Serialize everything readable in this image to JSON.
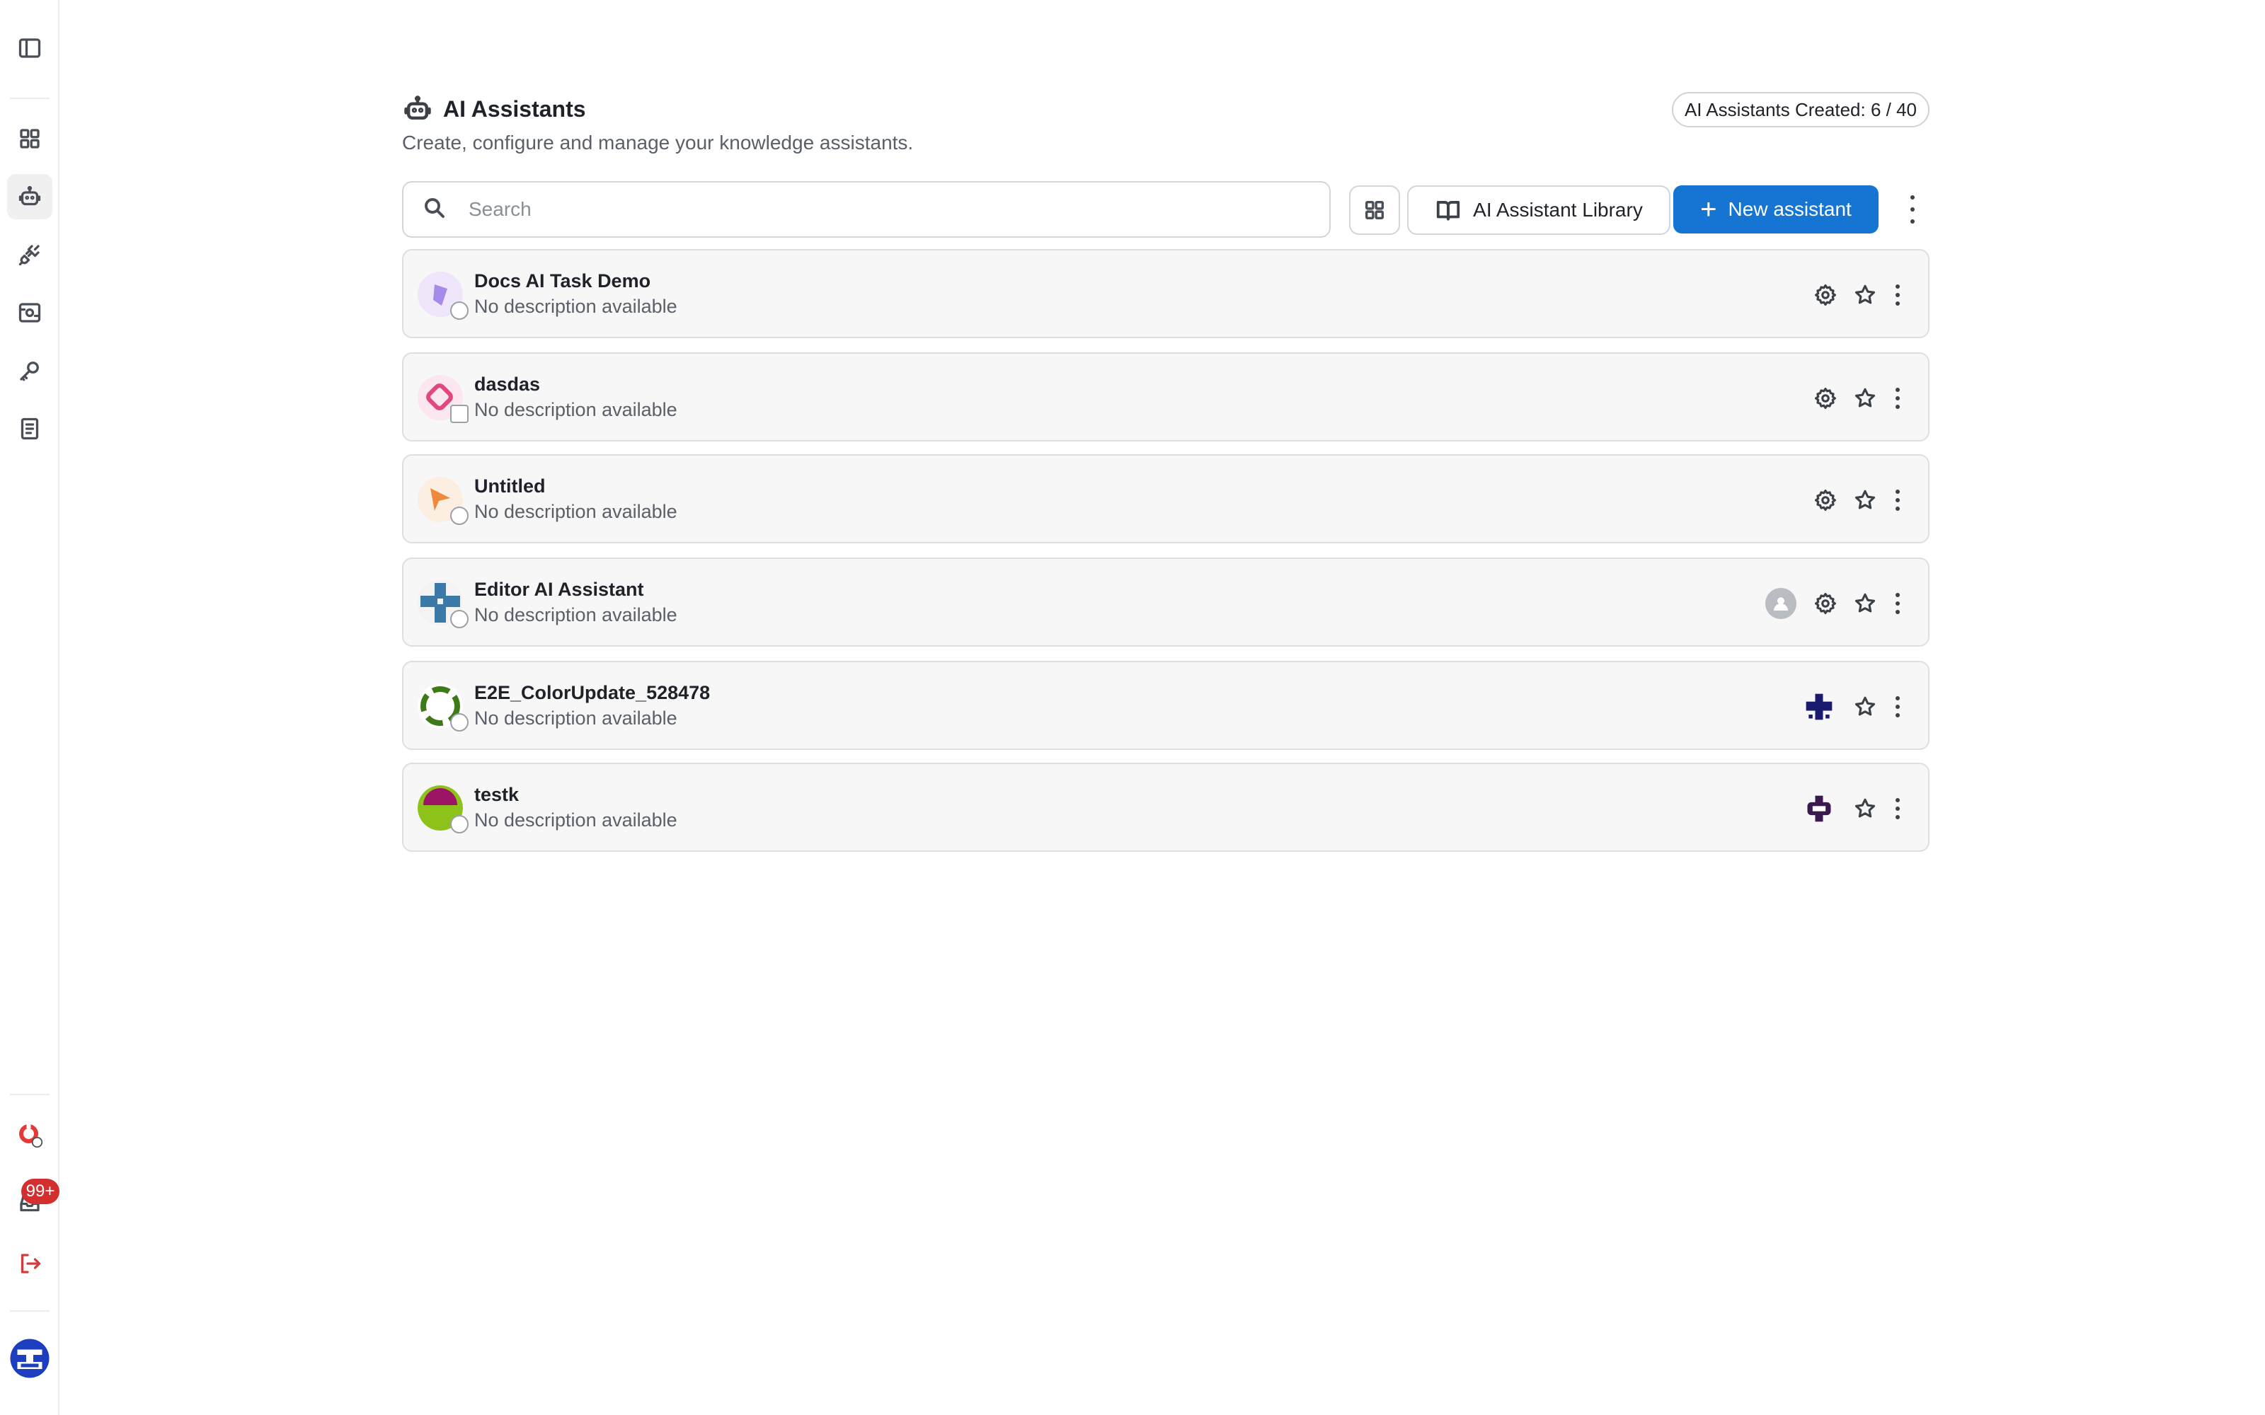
{
  "sidebar": {
    "notification_badge": "99+",
    "items": [
      {
        "name": "toggle-sidebar",
        "icon": "panel-left-icon"
      },
      {
        "name": "dashboard",
        "icon": "grid-icon"
      },
      {
        "name": "assistants",
        "icon": "robot-icon",
        "active": true
      },
      {
        "name": "integrations",
        "icon": "plug-icon"
      },
      {
        "name": "data-sources",
        "icon": "database-icon"
      },
      {
        "name": "api-keys",
        "icon": "key-icon"
      },
      {
        "name": "documentation",
        "icon": "book-icon"
      }
    ]
  },
  "header": {
    "title": "AI Assistants",
    "subtitle": "Create, configure and manage your knowledge assistants.",
    "quota": "AI Assistants Created: 6 / 40"
  },
  "toolbar": {
    "search_placeholder": "Search",
    "library_label": "AI Assistant Library",
    "new_label": "New assistant",
    "new_color": "#1674d3"
  },
  "assistants": [
    {
      "name": "Docs AI Task Demo",
      "description": "No description available"
    },
    {
      "name": "dasdas",
      "description": "No description available"
    },
    {
      "name": "Untitled",
      "description": "No description available"
    },
    {
      "name": "Editor AI Assistant",
      "description": "No description available"
    },
    {
      "name": "E2E_ColorUpdate_528478",
      "description": "No description available"
    },
    {
      "name": "testk",
      "description": "No description available"
    }
  ]
}
